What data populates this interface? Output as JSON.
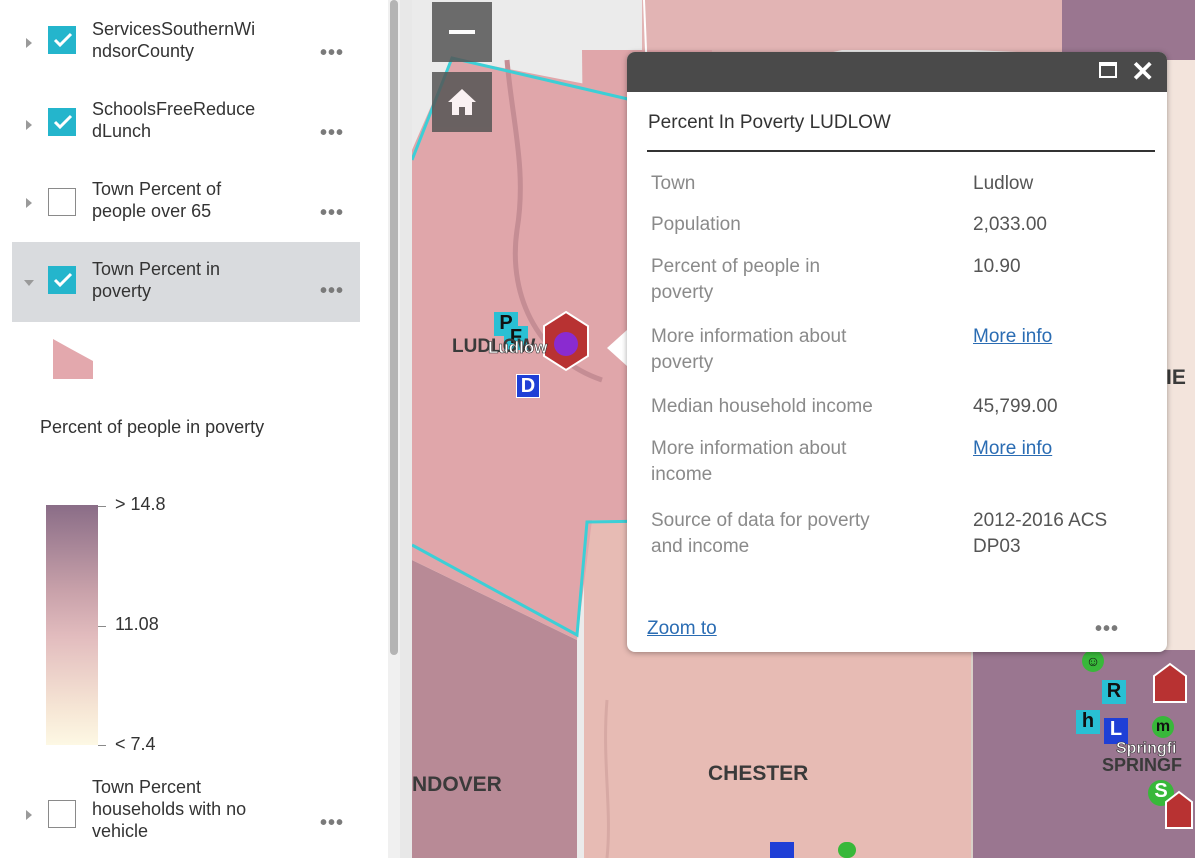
{
  "layers": [
    {
      "label": "ServicesSouthernWi\nndsorCounty",
      "checked": true,
      "expanded": false
    },
    {
      "label": "SchoolsFreeReduce\ndLunch",
      "checked": true,
      "expanded": false
    },
    {
      "label": "Town Percent of\npeople over 65",
      "checked": false,
      "expanded": false
    },
    {
      "label": "Town Percent in\npoverty",
      "checked": true,
      "expanded": true
    },
    {
      "label": "Town Percent\nhouseholds with no\nvehicle",
      "checked": false,
      "expanded": false
    }
  ],
  "layer_menu_label": "•••",
  "legend": {
    "title": "Percent of people in poverty",
    "ramp_labels": [
      "> 14.8",
      "11.08",
      "< 7.4"
    ],
    "swatch_color": "#e3a8ad",
    "ramp_colors": [
      "#8a6d87",
      "#e2bcbe",
      "#fdf8e4"
    ]
  },
  "map": {
    "town_labels": {
      "ludlow": "LUDLOW",
      "ludlow_marker": "Ludlow",
      "andover": "NDOVER",
      "chester": "CHESTER",
      "springfield": "SPRINGF",
      "springfield_marker": "Springfi",
      "east_edge": "IE"
    },
    "poi_letters": [
      "P",
      "F",
      "D",
      "R",
      "h",
      "L",
      "m",
      "S"
    ],
    "fill_colors": {
      "ludlow": "#e0a6aa",
      "andover": "#b88a96",
      "chester": "#e7bbb4",
      "east": "#9a7690",
      "north": "#e2b4b4",
      "outline": "#3ccfd6"
    }
  },
  "zoom_controls": {
    "zoom_out": "−",
    "home": "home"
  },
  "popup": {
    "title": "Percent In Poverty LUDLOW",
    "rows": [
      {
        "label": "Town",
        "value": "Ludlow"
      },
      {
        "label": "Population",
        "value": "2,033.00"
      },
      {
        "label": "Percent of people in\npoverty",
        "value": "10.90"
      },
      {
        "label": "More information about\npoverty",
        "value": "More info",
        "link": true
      },
      {
        "label": "Median household income",
        "value": "45,799.00"
      },
      {
        "label": "More information about\nincome",
        "value": "More info",
        "link": true
      },
      {
        "label": "Source of data for poverty\nand income",
        "value": "2012-2016 ACS\nDP03"
      }
    ],
    "zoom_to": "Zoom to",
    "menu": "•••"
  }
}
